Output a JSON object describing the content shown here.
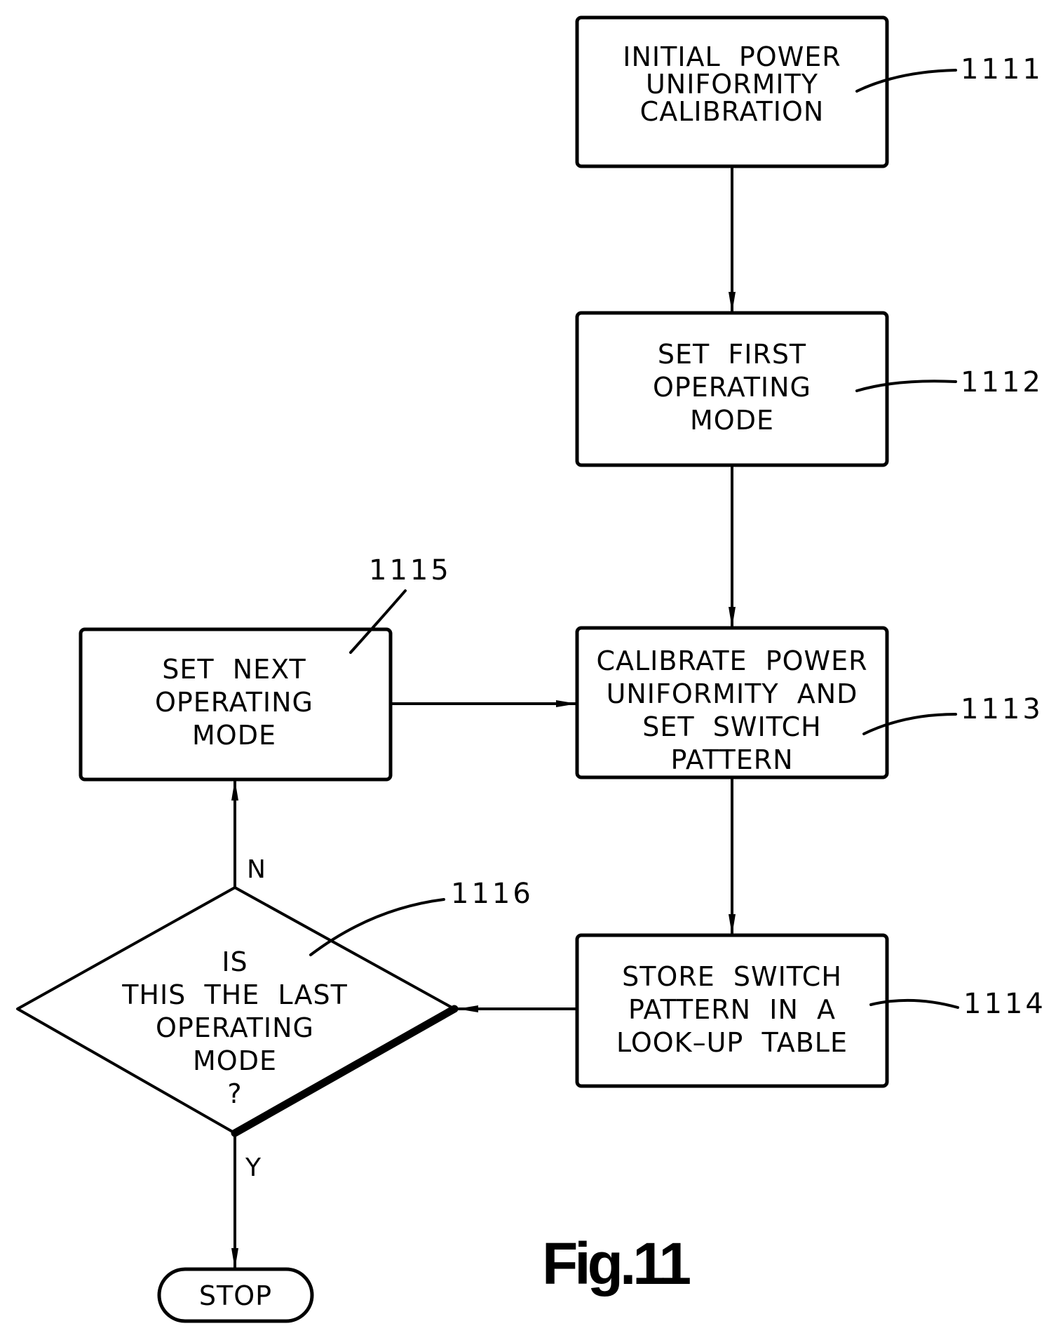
{
  "figure": {
    "caption": "Fig.11"
  },
  "nodes": {
    "n1111": {
      "ref": "1111",
      "lines": [
        "INITIAL  POWER",
        "UNIFORMITY",
        "CALIBRATION"
      ]
    },
    "n1112": {
      "ref": "1112",
      "lines": [
        "SET  FIRST",
        "OPERATING",
        "MODE"
      ]
    },
    "n1113": {
      "ref": "1113",
      "lines": [
        "CALIBRATE  POWER",
        "UNIFORMITY  AND",
        "SET  SWITCH",
        "PATTERN"
      ]
    },
    "n1114": {
      "ref": "1114",
      "lines": [
        "STORE  SWITCH",
        "PATTERN  IN  A",
        "LOOK–UP  TABLE"
      ]
    },
    "n1115": {
      "ref": "1115",
      "lines": [
        "SET  NEXT",
        "OPERATING",
        "MODE"
      ]
    },
    "n1116": {
      "ref": "1116",
      "lines": [
        "IS",
        "THIS  THE  LAST",
        "OPERATING",
        "MODE",
        "?"
      ]
    },
    "stop": {
      "label": "STOP"
    }
  },
  "branches": {
    "no": "N",
    "yes": "Y"
  }
}
